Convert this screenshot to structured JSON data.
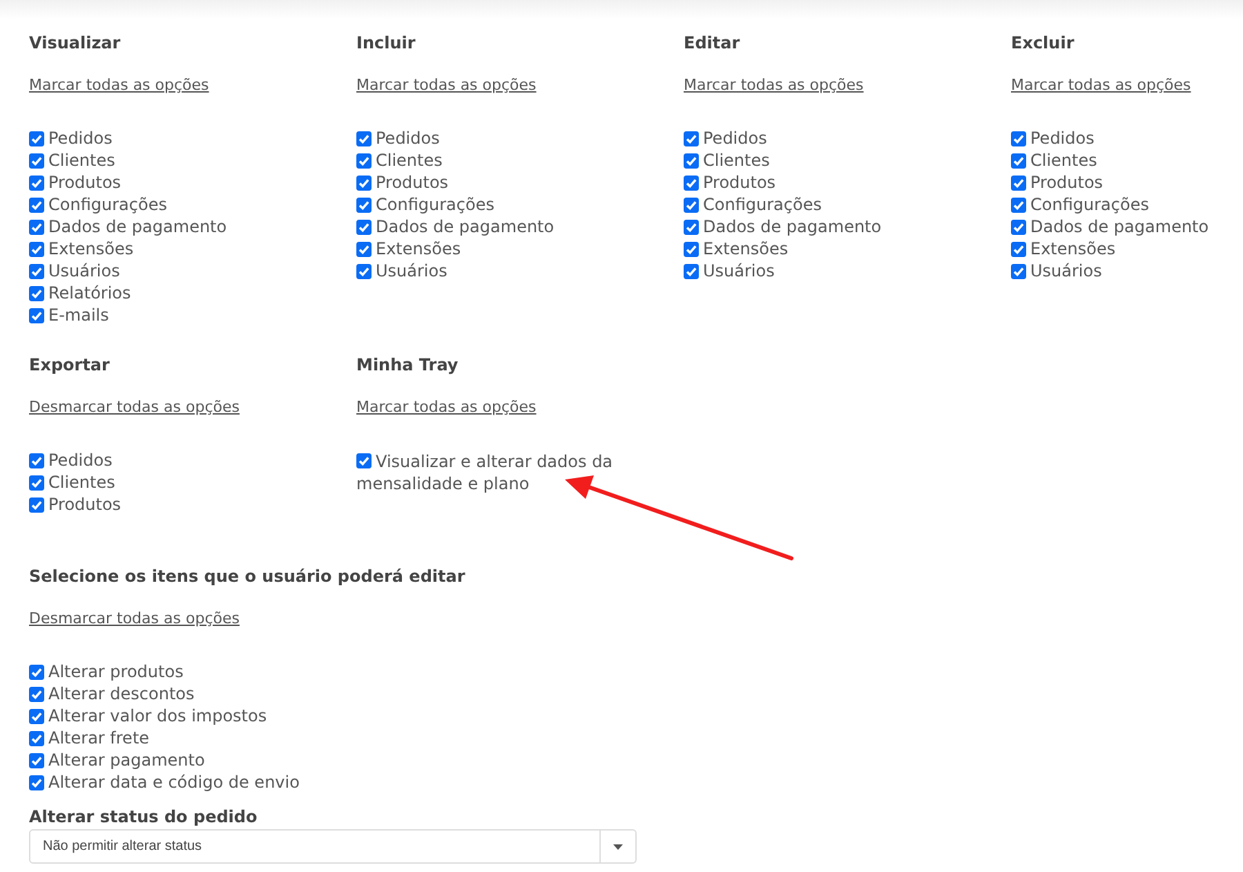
{
  "groups": [
    {
      "title": "Visualizar",
      "toggle_link": "Marcar todas as opções",
      "items": [
        {
          "label": "Pedidos",
          "checked": true
        },
        {
          "label": "Clientes",
          "checked": true
        },
        {
          "label": "Produtos",
          "checked": true
        },
        {
          "label": "Configurações",
          "checked": true
        },
        {
          "label": "Dados de pagamento",
          "checked": true
        },
        {
          "label": "Extensões",
          "checked": true
        },
        {
          "label": "Usuários",
          "checked": true
        },
        {
          "label": "Relatórios",
          "checked": true
        },
        {
          "label": "E-mails",
          "checked": true
        }
      ]
    },
    {
      "title": "Incluir",
      "toggle_link": "Marcar todas as opções",
      "items": [
        {
          "label": "Pedidos",
          "checked": true
        },
        {
          "label": "Clientes",
          "checked": true
        },
        {
          "label": "Produtos",
          "checked": true
        },
        {
          "label": "Configurações",
          "checked": true
        },
        {
          "label": "Dados de pagamento",
          "checked": true
        },
        {
          "label": "Extensões",
          "checked": true
        },
        {
          "label": "Usuários",
          "checked": true
        }
      ]
    },
    {
      "title": "Editar",
      "toggle_link": "Marcar todas as opções",
      "items": [
        {
          "label": "Pedidos",
          "checked": true
        },
        {
          "label": "Clientes",
          "checked": true
        },
        {
          "label": "Produtos",
          "checked": true
        },
        {
          "label": "Configurações",
          "checked": true
        },
        {
          "label": "Dados de pagamento",
          "checked": true
        },
        {
          "label": "Extensões",
          "checked": true
        },
        {
          "label": "Usuários",
          "checked": true
        }
      ]
    },
    {
      "title": "Excluir",
      "toggle_link": "Marcar todas as opções",
      "items": [
        {
          "label": "Pedidos",
          "checked": true
        },
        {
          "label": "Clientes",
          "checked": true
        },
        {
          "label": "Produtos",
          "checked": true
        },
        {
          "label": "Configurações",
          "checked": true
        },
        {
          "label": "Dados de pagamento",
          "checked": true
        },
        {
          "label": "Extensões",
          "checked": true
        },
        {
          "label": "Usuários",
          "checked": true
        }
      ]
    },
    {
      "title": "Exportar",
      "toggle_link": "Desmarcar todas as opções",
      "items": [
        {
          "label": "Pedidos",
          "checked": true
        },
        {
          "label": "Clientes",
          "checked": true
        },
        {
          "label": "Produtos",
          "checked": true
        }
      ]
    },
    {
      "title": "Minha Tray",
      "toggle_link": "Marcar todas as opções",
      "items": [
        {
          "label": "Visualizar e alterar dados da mensalidade e plano",
          "checked": true
        }
      ]
    }
  ],
  "edit_section": {
    "title": "Selecione os itens que o usuário poderá editar",
    "toggle_link": "Desmarcar todas as opções",
    "items": [
      {
        "label": "Alterar produtos",
        "checked": true
      },
      {
        "label": "Alterar descontos",
        "checked": true
      },
      {
        "label": "Alterar valor dos impostos",
        "checked": true
      },
      {
        "label": "Alterar frete",
        "checked": true
      },
      {
        "label": "Alterar pagamento",
        "checked": true
      },
      {
        "label": "Alterar data e código de envio",
        "checked": true
      }
    ]
  },
  "status_field": {
    "label": "Alterar status do pedido",
    "value": "Não permitir alterar status"
  }
}
